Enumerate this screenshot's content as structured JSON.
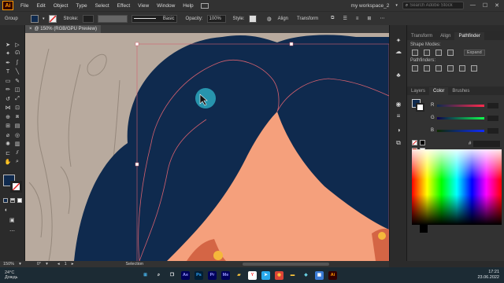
{
  "app": {
    "logo": "Ai"
  },
  "menu": [
    "File",
    "Edit",
    "Object",
    "Type",
    "Select",
    "Effect",
    "View",
    "Window",
    "Help"
  ],
  "workspace": "my workspace_2",
  "search": {
    "placeholder": "Search Adobe Stock"
  },
  "window_buttons": [
    "—",
    "☐",
    "✕"
  ],
  "control_bar": {
    "group_label": "Group",
    "stroke_label": "Stroke:",
    "brush_label": "Basic",
    "opacity_label": "Opacity:",
    "opacity_value": "100%",
    "style_label": "Style:",
    "align_label": "Align",
    "transform_label": "Transform"
  },
  "doc_tab": {
    "title": "@ 150% (RGB/GPU Preview)",
    "close": "×"
  },
  "tools": [
    {
      "icon": "selection-arrow-icon",
      "glyph": "➤"
    },
    {
      "icon": "direct-selection-icon",
      "glyph": "▷"
    },
    {
      "icon": "magic-wand-icon",
      "glyph": "✦"
    },
    {
      "icon": "lasso-icon",
      "glyph": "ᘏ"
    },
    {
      "icon": "pen-icon",
      "glyph": "✒"
    },
    {
      "icon": "curvature-icon",
      "glyph": "∫"
    },
    {
      "icon": "type-icon",
      "glyph": "T"
    },
    {
      "icon": "line-icon",
      "glyph": "╲"
    },
    {
      "icon": "rectangle-icon",
      "glyph": "▭"
    },
    {
      "icon": "paintbrush-icon",
      "glyph": "✎"
    },
    {
      "icon": "pencil-icon",
      "glyph": "✏"
    },
    {
      "icon": "eraser-icon",
      "glyph": "◫"
    },
    {
      "icon": "rotate-icon",
      "glyph": "↺"
    },
    {
      "icon": "scale-icon",
      "glyph": "⤢"
    },
    {
      "icon": "width-icon",
      "glyph": "⋈"
    },
    {
      "icon": "free-transform-icon",
      "glyph": "⊡"
    },
    {
      "icon": "shape-builder-icon",
      "glyph": "⊕"
    },
    {
      "icon": "perspective-icon",
      "glyph": "⧈"
    },
    {
      "icon": "mesh-icon",
      "glyph": "⊞"
    },
    {
      "icon": "gradient-icon",
      "glyph": "▤"
    },
    {
      "icon": "eyedropper-icon",
      "glyph": "⌀"
    },
    {
      "icon": "blend-icon",
      "glyph": "◎"
    },
    {
      "icon": "symbol-sprayer-icon",
      "glyph": "✺"
    },
    {
      "icon": "graph-icon",
      "glyph": "▥"
    },
    {
      "icon": "artboard-icon",
      "glyph": "⊏"
    },
    {
      "icon": "slice-icon",
      "glyph": "⫽"
    },
    {
      "icon": "hand-icon",
      "glyph": "✋"
    },
    {
      "icon": "zoom-icon",
      "glyph": "⌕"
    }
  ],
  "panels": {
    "top_tabs": [
      "Transform",
      "Align",
      "Pathfinder"
    ],
    "shape_modes_label": "Shape Modes:",
    "expand_label": "Expand",
    "pathfinders_label": "Pathfinders:",
    "color_tabs": [
      "Layers",
      "Color",
      "Brushes"
    ],
    "channels": [
      "R",
      "G",
      "B"
    ],
    "hex_prefix": "#"
  },
  "status": {
    "zoom": "150%",
    "angle": "0°",
    "artboard": "1",
    "tool": "Selection"
  },
  "taskbar": {
    "weather_temp": "24°C",
    "weather_desc": "Дождь",
    "apps": [
      {
        "icon": "windows-start-icon",
        "label": "⊞",
        "color": "#4cc2ff",
        "bg": "transparent"
      },
      {
        "icon": "search-icon",
        "label": "⌕",
        "color": "#ffffff",
        "bg": "transparent"
      },
      {
        "icon": "task-view-icon",
        "label": "❐",
        "color": "#ffffff",
        "bg": "transparent"
      },
      {
        "icon": "after-effects-icon",
        "label": "Ae",
        "color": "#9999ff",
        "bg": "#00005b"
      },
      {
        "icon": "photoshop-icon",
        "label": "Ps",
        "color": "#31a8ff",
        "bg": "#001e36"
      },
      {
        "icon": "premiere-icon",
        "label": "Pr",
        "color": "#9999ff",
        "bg": "#00005b"
      },
      {
        "icon": "media-encoder-icon",
        "label": "Me",
        "color": "#9999ff",
        "bg": "#00005b"
      },
      {
        "icon": "file-explorer-icon",
        "label": "▰",
        "color": "#ffc83d",
        "bg": "transparent"
      },
      {
        "icon": "yandex-browser-icon",
        "label": "Y",
        "color": "#ff3333",
        "bg": "#ffffff"
      },
      {
        "icon": "telegram-icon",
        "label": "➤",
        "color": "#ffffff",
        "bg": "#29a9eb"
      },
      {
        "icon": "chrome-icon",
        "label": "◉",
        "color": "#ffcd40",
        "bg": "#db4437"
      },
      {
        "icon": "folder-icon",
        "label": "▬",
        "color": "#ffc83d",
        "bg": "transparent"
      },
      {
        "icon": "app-icon",
        "label": "◆",
        "color": "#6ad1e3",
        "bg": "transparent"
      },
      {
        "icon": "photo-icon",
        "label": "▦",
        "color": "#ffffff",
        "bg": "#3a7bd5"
      },
      {
        "icon": "illustrator-icon",
        "label": "Ai",
        "color": "#ff9a00",
        "bg": "#330000"
      }
    ],
    "time": "17:21",
    "date": "23.06.2022"
  }
}
